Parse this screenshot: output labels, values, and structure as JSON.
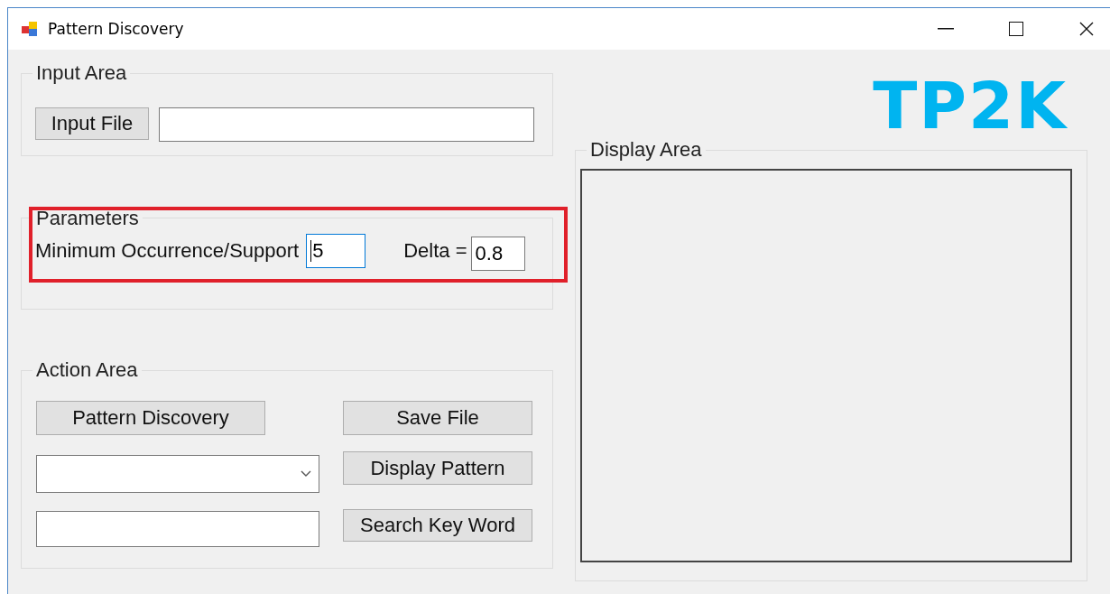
{
  "window": {
    "title": "Pattern Discovery"
  },
  "logo": "TP2K",
  "input_area": {
    "title": "Input Area",
    "button": "Input File"
  },
  "parameters": {
    "title": "Parameters",
    "highlighted": true,
    "min_support_label": "Minimum Occurrence/Support",
    "min_support_value": "5",
    "min_support_focused": true,
    "delta_label": "Delta =",
    "delta_value": "0.8"
  },
  "action_area": {
    "title": "Action Area",
    "buttons": [
      "Pattern Discovery",
      "Save File",
      "Display Pattern",
      "Search Key Word"
    ]
  },
  "display_area": {
    "title": "Display Area"
  }
}
